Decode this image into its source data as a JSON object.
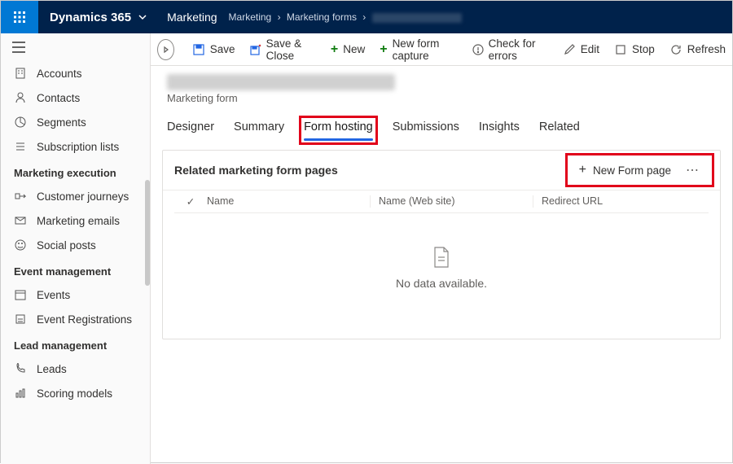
{
  "nav": {
    "brand": "Dynamics 365",
    "app": "Marketing",
    "crumb1": "Marketing",
    "crumb2": "Marketing forms"
  },
  "cmd": {
    "save": "Save",
    "saveclose": "Save & Close",
    "new": "New",
    "capture": "New form capture",
    "check": "Check for errors",
    "edit": "Edit",
    "stop": "Stop",
    "refresh": "Refresh"
  },
  "sidebar": {
    "accounts": "Accounts",
    "contacts": "Contacts",
    "segments": "Segments",
    "subs": "Subscription lists",
    "g1": "Marketing execution",
    "journeys": "Customer journeys",
    "emails": "Marketing emails",
    "social": "Social posts",
    "g2": "Event management",
    "events": "Events",
    "reg": "Event Registrations",
    "g3": "Lead management",
    "leads": "Leads",
    "scoring": "Scoring models"
  },
  "record": {
    "subtitle": "Marketing form"
  },
  "tabs": {
    "designer": "Designer",
    "summary": "Summary",
    "hosting": "Form hosting",
    "submissions": "Submissions",
    "insights": "Insights",
    "related": "Related"
  },
  "panel": {
    "title": "Related marketing form pages",
    "newbtn": "New Form page",
    "col1": "Name",
    "col2": "Name (Web site)",
    "col3": "Redirect URL",
    "empty": "No data available."
  }
}
